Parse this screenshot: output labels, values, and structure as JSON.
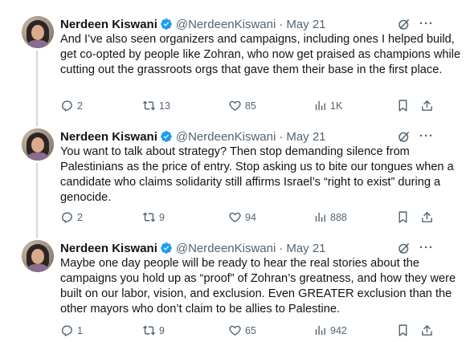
{
  "tweets": [
    {
      "name": "Nerdeen Kiswani",
      "handle": "@NerdeenKiswani",
      "dot": "·",
      "date": "May 21",
      "text": "And I’ve also seen organizers and campaigns, including ones I helped build, get co-opted by people like Zohran, who now get praised as champions while cutting out the grassroots orgs that gave them their base in the first place.",
      "replies": "2",
      "reposts": "13",
      "likes": "85",
      "views": "1K"
    },
    {
      "name": "Nerdeen Kiswani",
      "handle": "@NerdeenKiswani",
      "dot": "·",
      "date": "May 21",
      "text": "You want to talk about strategy? Then stop demanding silence from Palestinians as the price of entry. Stop asking us to bite our tongues when a candidate who claims solidarity still affirms Israel’s “right to exist” during a genocide.",
      "replies": "2",
      "reposts": "9",
      "likes": "94",
      "views": "888"
    },
    {
      "name": "Nerdeen Kiswani",
      "handle": "@NerdeenKiswani",
      "dot": "·",
      "date": "May 21",
      "text": "Maybe one day people will be ready to hear the real stories about the campaigns you hold up as “proof” of Zohran’s greatness, and how they were built on our labor, vision, and exclusion. Even GREATER exclusion than the other mayors who don’t claim to be allies to Palestine.",
      "replies": "1",
      "reposts": "9",
      "likes": "65",
      "views": "942"
    }
  ],
  "more_label": "···",
  "colors": {
    "text": "#0f1419",
    "muted": "#536471",
    "verified": "#1d9bf0",
    "thread_line": "#cfd9de"
  }
}
